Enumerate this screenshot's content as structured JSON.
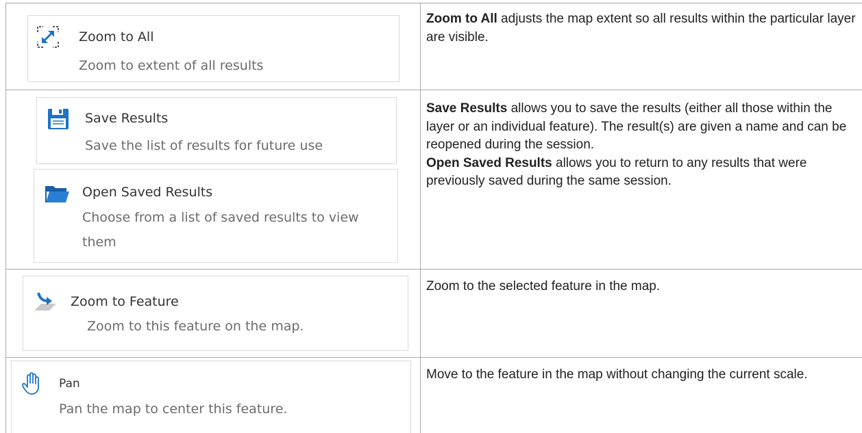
{
  "rows": [
    {
      "items": [
        {
          "icon": "zoom-to-all-icon",
          "title": "Zoom to All",
          "subtitle": "Zoom to extent of all results"
        }
      ],
      "description": [
        {
          "bold": "Zoom to All",
          "text": " adjusts the map extent so all results within the particular layer are visible."
        }
      ]
    },
    {
      "items": [
        {
          "icon": "save-icon",
          "title": "Save Results",
          "subtitle": "Save the list of results for future use"
        },
        {
          "icon": "folder-open-icon",
          "title": "Open Saved Results",
          "subtitle": "Choose from a list of saved results to view them"
        }
      ],
      "description": [
        {
          "bold": "Save Results",
          "text": " allows you to save the results (either all those within the layer or an individual feature). The result(s) are given a name and can be reopened during the session."
        },
        {
          "bold": "Open Saved Results",
          "text": " allows you to return to any results that were previously saved during the same session."
        }
      ]
    },
    {
      "items": [
        {
          "icon": "zoom-to-feature-icon",
          "title": "Zoom to Feature",
          "subtitle": "Zoom to this feature on the map."
        }
      ],
      "description": [
        {
          "bold": "",
          "text": "Zoom to the selected feature in the map."
        }
      ]
    },
    {
      "items": [
        {
          "icon": "pan-hand-icon",
          "title": "Pan",
          "subtitle": "Pan the map to center this feature."
        }
      ],
      "description": [
        {
          "bold": "",
          "text": "Move to the feature in the map without changing the current scale."
        }
      ]
    }
  ]
}
